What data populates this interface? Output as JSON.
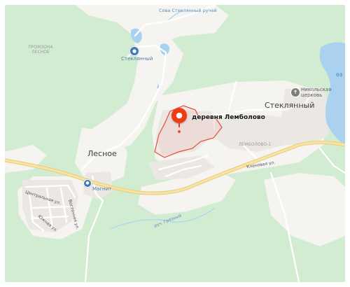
{
  "map": {
    "labels": {
      "sova_stream": "Сова Стеклянный ручей",
      "promzona": "ПРОМЗОНА ЛЕСНОЕ",
      "steklyanny_poi": "Стеклянный",
      "lesnoe": "Лесное",
      "steklyanny_village": "Стеклянный",
      "church": "Никольская церковь",
      "lembolovo_label": "деревня Лемболово",
      "lembolovo_1": "ЛЕМБОЛОВО-1",
      "klenovaya": "Кленовая ул.",
      "magnit": "Магнит",
      "tsentralnaya": "Центральная ул.",
      "vostochnaya": "Восточная ул.",
      "yuzhnaya": "Южная ул.",
      "grayvaya": "руч. Грязный",
      "lake_partial": "оз"
    },
    "colors": {
      "forest": "#d2ecd2",
      "open_land": "#f5f4f0",
      "settlement": "#ebe8e4",
      "water": "#aad2f0",
      "main_road": "#f4d98a",
      "marker": "#f03a17",
      "boundary": "#e54b3a",
      "poi": "#3f78b5"
    },
    "icons": [
      "pin-icon",
      "poi-icon",
      "church-icon",
      "shopping-icon"
    ]
  }
}
